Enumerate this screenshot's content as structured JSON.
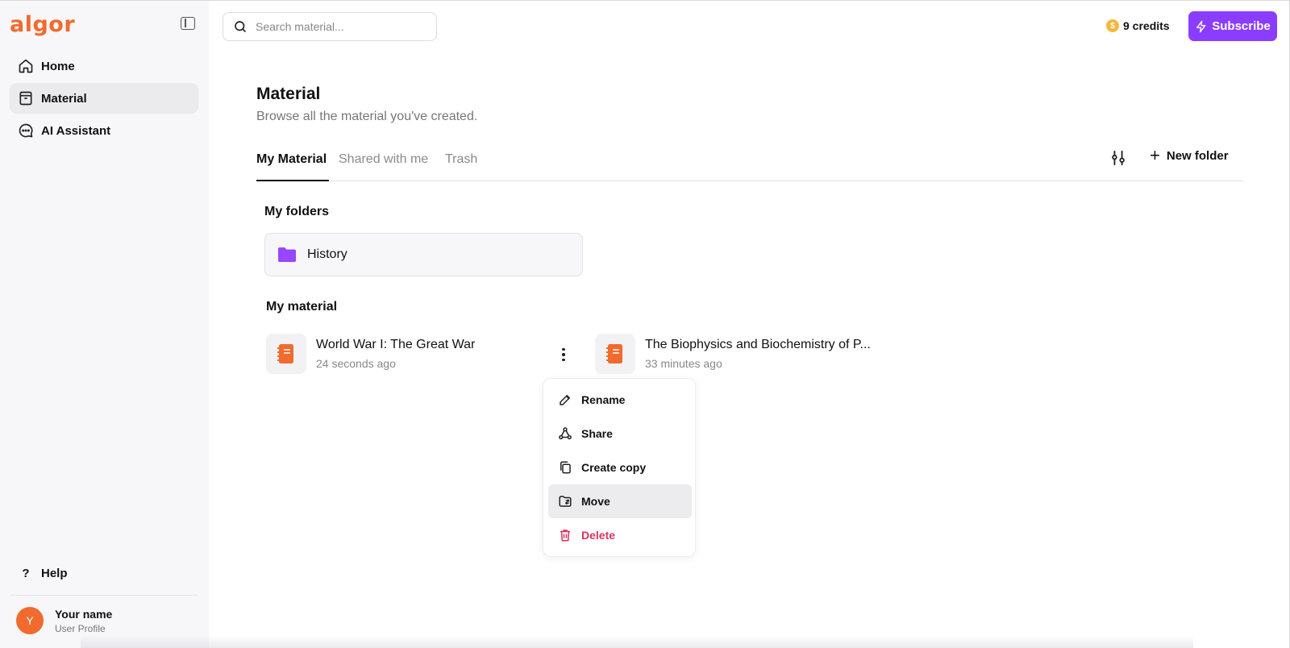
{
  "app": {
    "logo": "algor"
  },
  "sidebar": {
    "items": [
      {
        "label": "Home",
        "icon": "home-icon"
      },
      {
        "label": "Material",
        "icon": "material-icon",
        "active": true
      },
      {
        "label": "AI Assistant",
        "icon": "ai-assistant-icon"
      }
    ],
    "help_label": "Help",
    "profile": {
      "initial": "Y",
      "name": "Your name",
      "subtitle": "User Profile"
    }
  },
  "topbar": {
    "search_placeholder": "Search material...",
    "credits": "9 credits",
    "subscribe_label": "Subscribe"
  },
  "main": {
    "title": "Material",
    "subtitle": "Browse all the material you've created.",
    "tabs": [
      {
        "label": "My Material",
        "active": true
      },
      {
        "label": "Shared with me"
      },
      {
        "label": "Trash"
      }
    ],
    "new_folder_label": "New folder",
    "folders_heading": "My folders",
    "folders": [
      {
        "name": "History"
      }
    ],
    "material_heading": "My material",
    "materials": [
      {
        "title": "World War I: The Great War",
        "time": "24 seconds ago"
      },
      {
        "title": "The Biophysics and Biochemistry of P...",
        "time": "33 minutes ago"
      }
    ]
  },
  "context_menu": {
    "items": [
      {
        "label": "Rename",
        "icon": "pencil-icon"
      },
      {
        "label": "Share",
        "icon": "share-icon"
      },
      {
        "label": "Create copy",
        "icon": "copy-icon"
      },
      {
        "label": "Move",
        "icon": "folder-move-icon",
        "highlighted": true
      },
      {
        "label": "Delete",
        "icon": "trash-icon",
        "danger": true
      }
    ]
  },
  "colors": {
    "brand": "#f26a2e",
    "accent": "#8b3dff",
    "folder": "#9747ff",
    "danger": "#d8335f"
  }
}
